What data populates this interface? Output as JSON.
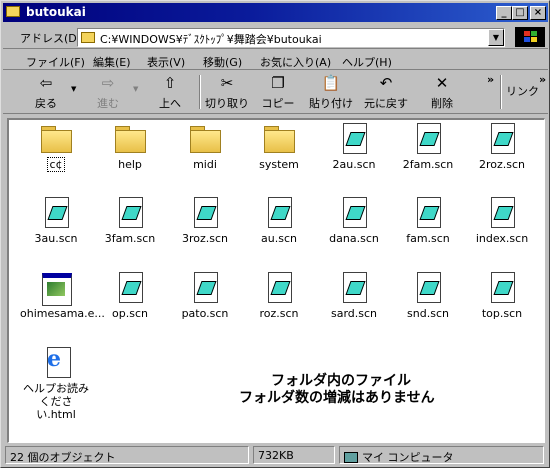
{
  "window": {
    "title": "butoukai",
    "minimize_glyph": "_",
    "maximize_glyph": "□",
    "close_glyph": "×"
  },
  "address": {
    "label": "アドレス(D)",
    "value": "C:¥WINDOWS¥ﾃﾞｽｸﾄｯﾌﾟ¥舞踏会¥butoukai"
  },
  "menu": {
    "items": [
      "ファイル(F)",
      "編集(E)",
      "表示(V)",
      "移動(G)",
      "お気に入り(A)",
      "ヘルプ(H)"
    ]
  },
  "toolbar": {
    "back": "戻る",
    "forward": "進む",
    "up": "上へ",
    "cut": "切り取り",
    "copy": "コピー",
    "paste": "貼り付け",
    "undo": "元に戻す",
    "delete": "削除",
    "more": "»",
    "links": "リンク",
    "links_more": "»"
  },
  "files": [
    {
      "name": "c¢",
      "type": "folder"
    },
    {
      "name": "help",
      "type": "folder"
    },
    {
      "name": "midi",
      "type": "folder"
    },
    {
      "name": "system",
      "type": "folder"
    },
    {
      "name": "2au.scn",
      "type": "scn"
    },
    {
      "name": "2fam.scn",
      "type": "scn"
    },
    {
      "name": "2roz.scn",
      "type": "scn"
    },
    {
      "name": "3au.scn",
      "type": "scn"
    },
    {
      "name": "3fam.scn",
      "type": "scn"
    },
    {
      "name": "3roz.scn",
      "type": "scn"
    },
    {
      "name": "au.scn",
      "type": "scn"
    },
    {
      "name": "dana.scn",
      "type": "scn"
    },
    {
      "name": "fam.scn",
      "type": "scn"
    },
    {
      "name": "index.scn",
      "type": "scn"
    },
    {
      "name": "ohimesama.e...",
      "type": "exe"
    },
    {
      "name": "op.scn",
      "type": "scn"
    },
    {
      "name": "pato.scn",
      "type": "scn"
    },
    {
      "name": "roz.scn",
      "type": "scn"
    },
    {
      "name": "sard.scn",
      "type": "scn"
    },
    {
      "name": "snd.scn",
      "type": "scn"
    },
    {
      "name": "top.scn",
      "type": "scn"
    },
    {
      "name": "ヘルプお読み\nください.html",
      "type": "html"
    }
  ],
  "annotation": {
    "line1": "フォルダ内のファイル",
    "line2": "フォルダ数の増減はありません"
  },
  "status": {
    "count": "22 個のオブジェクト",
    "size": "732KB",
    "location": "マイ コンピュータ"
  },
  "colors": {
    "titlebar_start": "#00007b",
    "titlebar_end": "#2d5fd0",
    "window_face": "#c0c0c0",
    "desktop": "#008080",
    "file_icon_accent": "#3fd8c8"
  }
}
